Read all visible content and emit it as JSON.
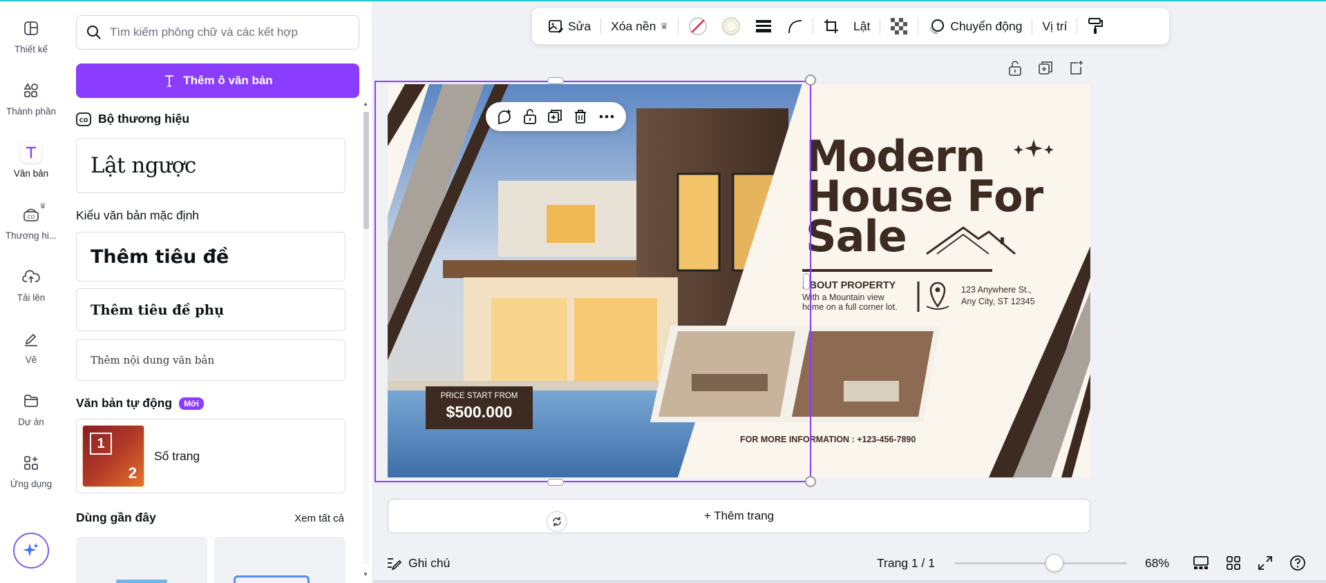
{
  "rail": {
    "items": [
      {
        "label": "Thiết kế",
        "icon": "layout-icon"
      },
      {
        "label": "Thành phần",
        "icon": "shapes-icon"
      },
      {
        "label": "Văn bản",
        "icon": "text-icon"
      },
      {
        "label": "Thương hi...",
        "icon": "brand-icon"
      },
      {
        "label": "Tải lên",
        "icon": "cloud-upload-icon"
      },
      {
        "label": "Vẽ",
        "icon": "draw-pen-icon"
      },
      {
        "label": "Dự án",
        "icon": "folder-icon"
      },
      {
        "label": "Ứng dụng",
        "icon": "apps-icon"
      }
    ],
    "active_index": 2
  },
  "panel": {
    "search_placeholder": "Tìm kiếm phông chữ và các kết hợp",
    "add_textbox_label": "Thêm ô văn bản",
    "brand_kit_label": "Bộ thương hiệu",
    "brand_sample": "Lật ngược",
    "default_styles_heading": "Kiểu văn bản mặc định",
    "heading_sample": "Thêm tiêu đề",
    "subheading_sample": "Thêm tiêu đề phụ",
    "body_sample": "Thêm nội dung văn bản",
    "auto_text_heading": "Văn bản tự động",
    "new_badge": "Mới",
    "page_number_label": "Số trang",
    "page_thumb_1": "1",
    "page_thumb_2": "2",
    "recent_heading": "Dùng gần đây",
    "see_all": "Xem tất cả"
  },
  "toolbar": {
    "edit": "Sửa",
    "remove_bg": "Xóa nền",
    "flip": "Lật",
    "animate": "Chuyển động",
    "position": "Vị trí"
  },
  "design": {
    "title_line1": "Modern",
    "title_line2": "House For",
    "title_line3": "Sale",
    "about_heading": "ABOUT PROPERTY",
    "about_body1": "With  a Mountain view",
    "about_body2": "home on a full corner lot.",
    "address1": "123 Anywhere St.,",
    "address2": "Any City, ST 12345",
    "price_label": "PRICE START FROM",
    "price_value": "$500.000",
    "info_line": "FOR MORE INFORMATION : +123-456-7890",
    "colors": {
      "brown": "#3d2a20",
      "taupe": "#a9a29a",
      "cream": "#faf6ee"
    }
  },
  "add_page_label": "+ Thêm trang",
  "bottom": {
    "notes_label": "Ghi chú",
    "page_indicator": "Trang 1 / 1",
    "zoom_label": "68%",
    "zoom_fraction": 0.68
  },
  "colors": {
    "accent": "#8b3dff",
    "teal": "#1ec8d0"
  }
}
